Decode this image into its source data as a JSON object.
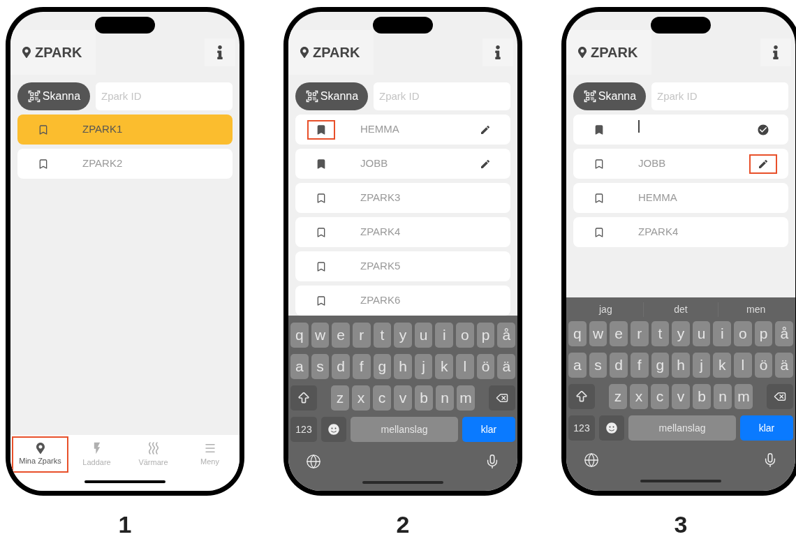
{
  "phones": [
    {
      "step": "1",
      "logo": "ZPARK",
      "scan_button": "Skanna",
      "id_field": {
        "placeholder": "Zpark ID"
      },
      "list": [
        {
          "kind": "entry",
          "label": "ZPARK1",
          "selected": true,
          "bookmarked": false,
          "icon_callout": false
        },
        {
          "kind": "entry",
          "label": "ZPARK2",
          "selected": false,
          "bookmarked": false,
          "icon_callout": false
        }
      ],
      "tabs": [
        {
          "label": "Mina Zparks",
          "selected": true,
          "callout": true
        },
        {
          "label": "Laddare",
          "selected": false,
          "callout": false
        },
        {
          "label": "Värmare",
          "selected": false,
          "callout": false
        },
        {
          "label": "Meny",
          "selected": false,
          "callout": false
        }
      ]
    },
    {
      "step": "2",
      "logo": "ZPARK",
      "scan_button": "Skanna",
      "id_field": {
        "placeholder": "Zpark ID"
      },
      "list": [
        {
          "kind": "entry",
          "label": "HEMMA",
          "selected": false,
          "bookmarked": true,
          "action": {
            "kind": "edit"
          },
          "icon_callout": true,
          "action_callout": false
        },
        {
          "kind": "entry",
          "label": "JOBB",
          "selected": false,
          "bookmarked": true,
          "action": {
            "kind": "edit"
          },
          "icon_callout": false,
          "action_callout": false
        },
        {
          "kind": "entry",
          "label": "ZPARK3",
          "selected": false,
          "bookmarked": false,
          "icon_callout": false
        },
        {
          "kind": "entry",
          "label": "ZPARK4",
          "selected": false,
          "bookmarked": false,
          "icon_callout": false
        },
        {
          "kind": "entry",
          "label": "ZPARK5",
          "selected": false,
          "bookmarked": false,
          "icon_callout": false
        },
        {
          "kind": "entry",
          "label": "ZPARK6",
          "selected": false,
          "bookmarked": false,
          "icon_callout": false
        }
      ],
      "keyboard": {
        "rows": [
          [
            "q",
            "w",
            "e",
            "r",
            "t",
            "y",
            "u",
            "i",
            "o",
            "p",
            "å"
          ],
          [
            "a",
            "s",
            "d",
            "f",
            "g",
            "h",
            "j",
            "k",
            "l",
            "ö",
            "ä"
          ]
        ],
        "short_row": [
          "z",
          "x",
          "c",
          "v",
          "b",
          "n",
          "m"
        ],
        "numbers_key": "123",
        "space_key": "mellanslag",
        "return_key": "klar"
      }
    },
    {
      "step": "3",
      "logo": "ZPARK",
      "scan_button": "Skanna",
      "id_field": {
        "placeholder": "Zpark ID"
      },
      "list": [
        {
          "kind": "input",
          "selected": false,
          "bookmarked": true,
          "action": {
            "kind": "confirm"
          },
          "icon_callout": false,
          "action_callout": false
        },
        {
          "kind": "entry",
          "label": "JOBB",
          "selected": false,
          "bookmarked": false,
          "action": {
            "kind": "edit"
          },
          "icon_callout": false,
          "action_callout": true
        },
        {
          "kind": "entry",
          "label": "HEMMA",
          "selected": false,
          "bookmarked": false,
          "icon_callout": false
        },
        {
          "kind": "entry",
          "label": "ZPARK4",
          "selected": false,
          "bookmarked": false,
          "icon_callout": false
        }
      ],
      "keyboard": {
        "suggestions": [
          "jag",
          "det",
          "men"
        ],
        "rows": [
          [
            "q",
            "w",
            "e",
            "r",
            "t",
            "y",
            "u",
            "i",
            "o",
            "p",
            "å"
          ],
          [
            "a",
            "s",
            "d",
            "f",
            "g",
            "h",
            "j",
            "k",
            "l",
            "ö",
            "ä"
          ]
        ],
        "short_row": [
          "z",
          "x",
          "c",
          "v",
          "b",
          "n",
          "m"
        ],
        "numbers_key": "123",
        "space_key": "mellanslag",
        "return_key": "klar"
      }
    }
  ]
}
